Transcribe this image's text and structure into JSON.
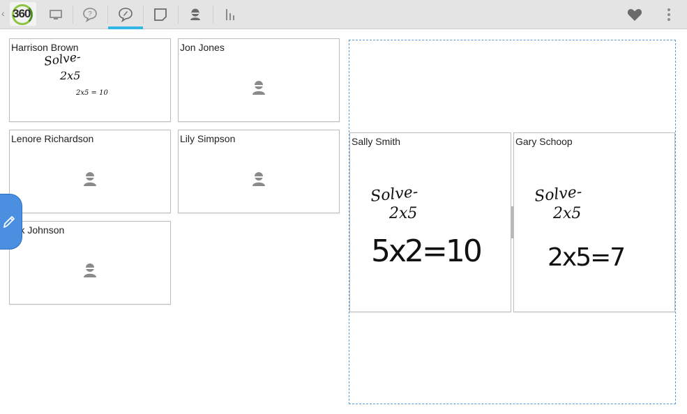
{
  "toolbar": {
    "logo_text": "360",
    "tabs": [
      {
        "icon": "monitor-icon"
      },
      {
        "icon": "question-bubble-icon"
      },
      {
        "icon": "answer-bubble-icon",
        "active": true
      },
      {
        "icon": "note-icon"
      },
      {
        "icon": "student-icon"
      },
      {
        "icon": "bar-chart-icon"
      }
    ],
    "right_icons": [
      "heart-icon",
      "more-vert-icon"
    ],
    "accent_color": "#33b5e5"
  },
  "students_grid": [
    {
      "name": "Harrison Brown",
      "has_answer": true,
      "answer_lines": [
        "Solve-",
        "2x5",
        "2x5 = 10"
      ]
    },
    {
      "name": "Jon Jones",
      "has_answer": false
    },
    {
      "name": "Lenore Richardson",
      "has_answer": false
    },
    {
      "name": "Lily Simpson",
      "has_answer": false
    },
    {
      "name": "ark  Johnson",
      "has_answer": false
    }
  ],
  "compare_panel": [
    {
      "name": "Sally Smith",
      "answer_lines": [
        "Solve-",
        "2x5",
        "5x2=10"
      ]
    },
    {
      "name": "Gary Schoop",
      "answer_lines": [
        "Solve-",
        "2x5",
        "2x5=7"
      ]
    }
  ],
  "pen_tab": {
    "icon": "pencil-icon",
    "color": "#4a8fe0"
  }
}
